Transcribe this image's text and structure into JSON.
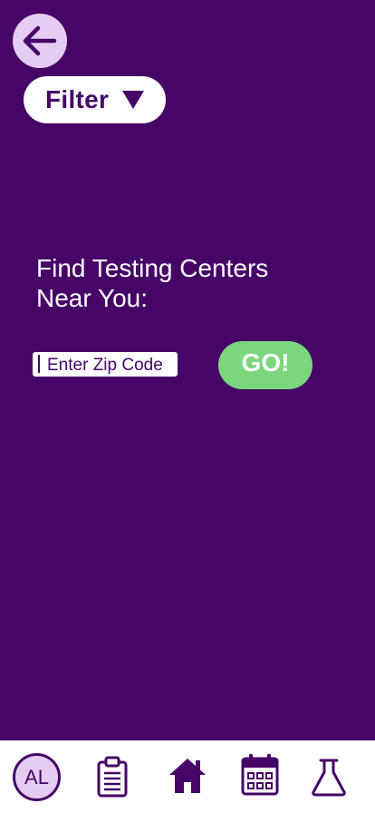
{
  "header": {
    "back_icon": "arrow-left-icon",
    "filter_label": "Filter",
    "filter_icon": "caret-down-icon"
  },
  "main": {
    "heading_line1": "Find Testing Centers",
    "heading_line2": "Near You:",
    "zip_placeholder": "Enter Zip Code",
    "zip_value": "",
    "go_label": "GO!"
  },
  "nav": {
    "profile_initials": "AL",
    "items": [
      {
        "name": "profile",
        "icon": "avatar"
      },
      {
        "name": "records",
        "icon": "clipboard-icon"
      },
      {
        "name": "home",
        "icon": "home-icon"
      },
      {
        "name": "calendar",
        "icon": "calendar-icon"
      },
      {
        "name": "tests",
        "icon": "flask-icon"
      }
    ]
  },
  "colors": {
    "background": "#460567",
    "accent_light": "#e6ccf3",
    "go_green": "#7bd67e",
    "white": "#ffffff"
  }
}
